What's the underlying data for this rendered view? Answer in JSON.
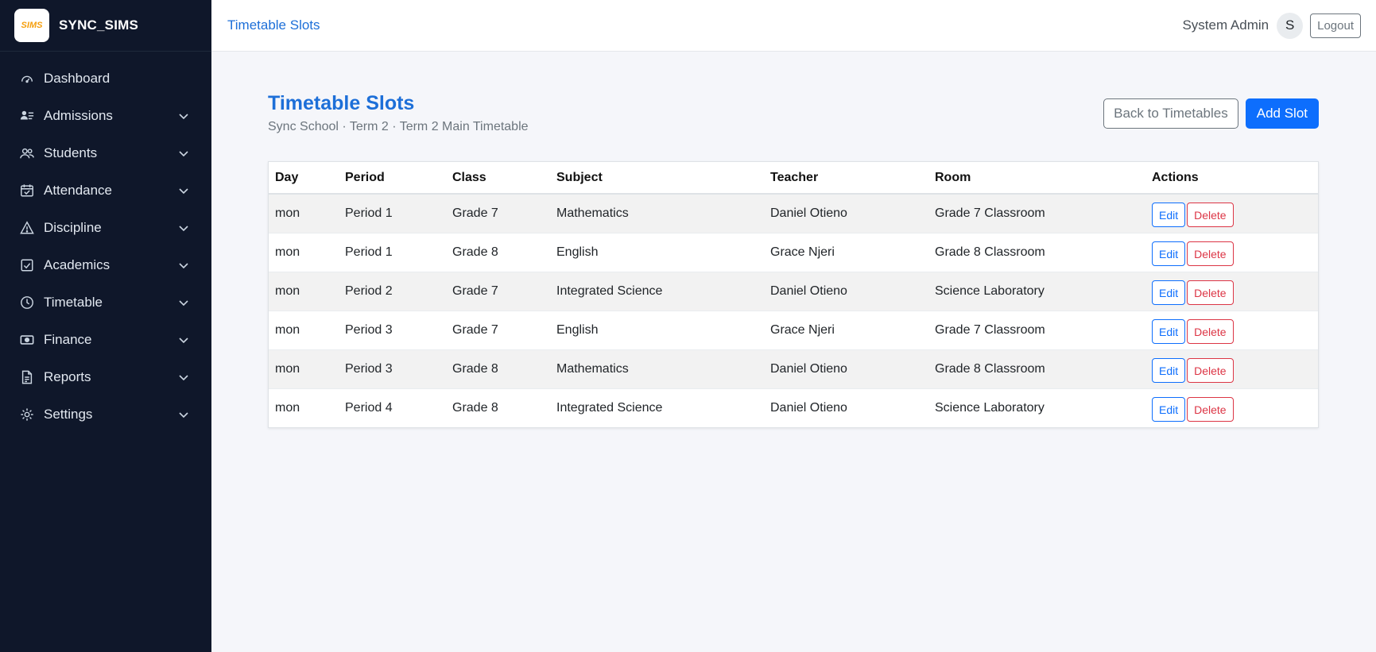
{
  "brand": {
    "name": "SYNC_SIMS",
    "logo_text": "SIMS"
  },
  "sidebar": {
    "items": [
      {
        "label": "Dashboard",
        "icon": "gauge-icon",
        "has_submenu": false
      },
      {
        "label": "Admissions",
        "icon": "user-list-icon",
        "has_submenu": true
      },
      {
        "label": "Students",
        "icon": "people-icon",
        "has_submenu": true
      },
      {
        "label": "Attendance",
        "icon": "calendar-check-icon",
        "has_submenu": true
      },
      {
        "label": "Discipline",
        "icon": "warning-icon",
        "has_submenu": true
      },
      {
        "label": "Academics",
        "icon": "checkbox-icon",
        "has_submenu": true
      },
      {
        "label": "Timetable",
        "icon": "clock-icon",
        "has_submenu": true
      },
      {
        "label": "Finance",
        "icon": "cash-icon",
        "has_submenu": true
      },
      {
        "label": "Reports",
        "icon": "report-icon",
        "has_submenu": true
      },
      {
        "label": "Settings",
        "icon": "gear-icon",
        "has_submenu": true
      }
    ]
  },
  "topbar": {
    "breadcrumb": "Timetable Slots",
    "user_name": "System Admin",
    "avatar_initial": "S",
    "logout_label": "Logout"
  },
  "page": {
    "title": "Timetable Slots",
    "subtitle": "Sync School · Term 2 · Term 2 Main Timetable",
    "back_label": "Back to Timetables",
    "add_label": "Add Slot"
  },
  "table": {
    "headers": [
      "Day",
      "Period",
      "Class",
      "Subject",
      "Teacher",
      "Room",
      "Actions"
    ],
    "edit_label": "Edit",
    "delete_label": "Delete",
    "rows": [
      [
        "mon",
        "Period 1",
        "Grade 7",
        "Mathematics",
        "Daniel Otieno",
        "Grade 7 Classroom"
      ],
      [
        "mon",
        "Period 1",
        "Grade 8",
        "English",
        "Grace Njeri",
        "Grade 8 Classroom"
      ],
      [
        "mon",
        "Period 2",
        "Grade 7",
        "Integrated Science",
        "Daniel Otieno",
        "Science Laboratory"
      ],
      [
        "mon",
        "Period 3",
        "Grade 7",
        "English",
        "Grace Njeri",
        "Grade 7 Classroom"
      ],
      [
        "mon",
        "Period 3",
        "Grade 8",
        "Mathematics",
        "Daniel Otieno",
        "Grade 8 Classroom"
      ],
      [
        "mon",
        "Period 4",
        "Grade 8",
        "Integrated Science",
        "Daniel Otieno",
        "Science Laboratory"
      ]
    ]
  },
  "colors": {
    "sidebar_bg": "#0f172a",
    "accent": "#1d6fd8",
    "primary": "#0d6efd",
    "danger": "#dc3545"
  }
}
